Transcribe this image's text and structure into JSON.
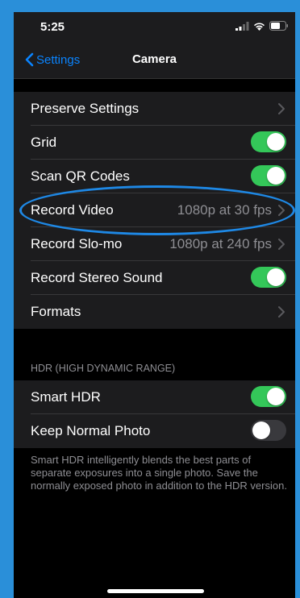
{
  "status_bar": {
    "time": "5:25",
    "icons": [
      "signal-icon",
      "wifi-icon",
      "battery-icon"
    ]
  },
  "nav": {
    "back_label": "Settings",
    "title": "Camera"
  },
  "camera_settings": [
    {
      "label": "Preserve Settings",
      "type": "disclosure"
    },
    {
      "label": "Grid",
      "type": "toggle",
      "on": true
    },
    {
      "label": "Scan QR Codes",
      "type": "toggle",
      "on": true
    },
    {
      "label": "Record Video",
      "type": "disclosure",
      "value": "1080p at 30 fps"
    },
    {
      "label": "Record Slo-mo",
      "type": "disclosure",
      "value": "1080p at 240 fps"
    },
    {
      "label": "Record Stereo Sound",
      "type": "toggle",
      "on": true
    },
    {
      "label": "Formats",
      "type": "disclosure"
    }
  ],
  "hdr_section": {
    "header": "HDR (HIGH DYNAMIC RANGE)",
    "items": [
      {
        "label": "Smart HDR",
        "type": "toggle",
        "on": true
      },
      {
        "label": "Keep Normal Photo",
        "type": "toggle",
        "on": false
      }
    ],
    "footer": "Smart HDR intelligently blends the best parts of separate exposures into a single photo. Save the normally exposed photo in addition to the HDR version."
  },
  "colors": {
    "accent": "#0a84ff",
    "toggle_on": "#34c759",
    "toggle_off": "#39393d",
    "annotation": "#1e88e5",
    "background": "#000000",
    "cell": "#1c1c1e"
  }
}
